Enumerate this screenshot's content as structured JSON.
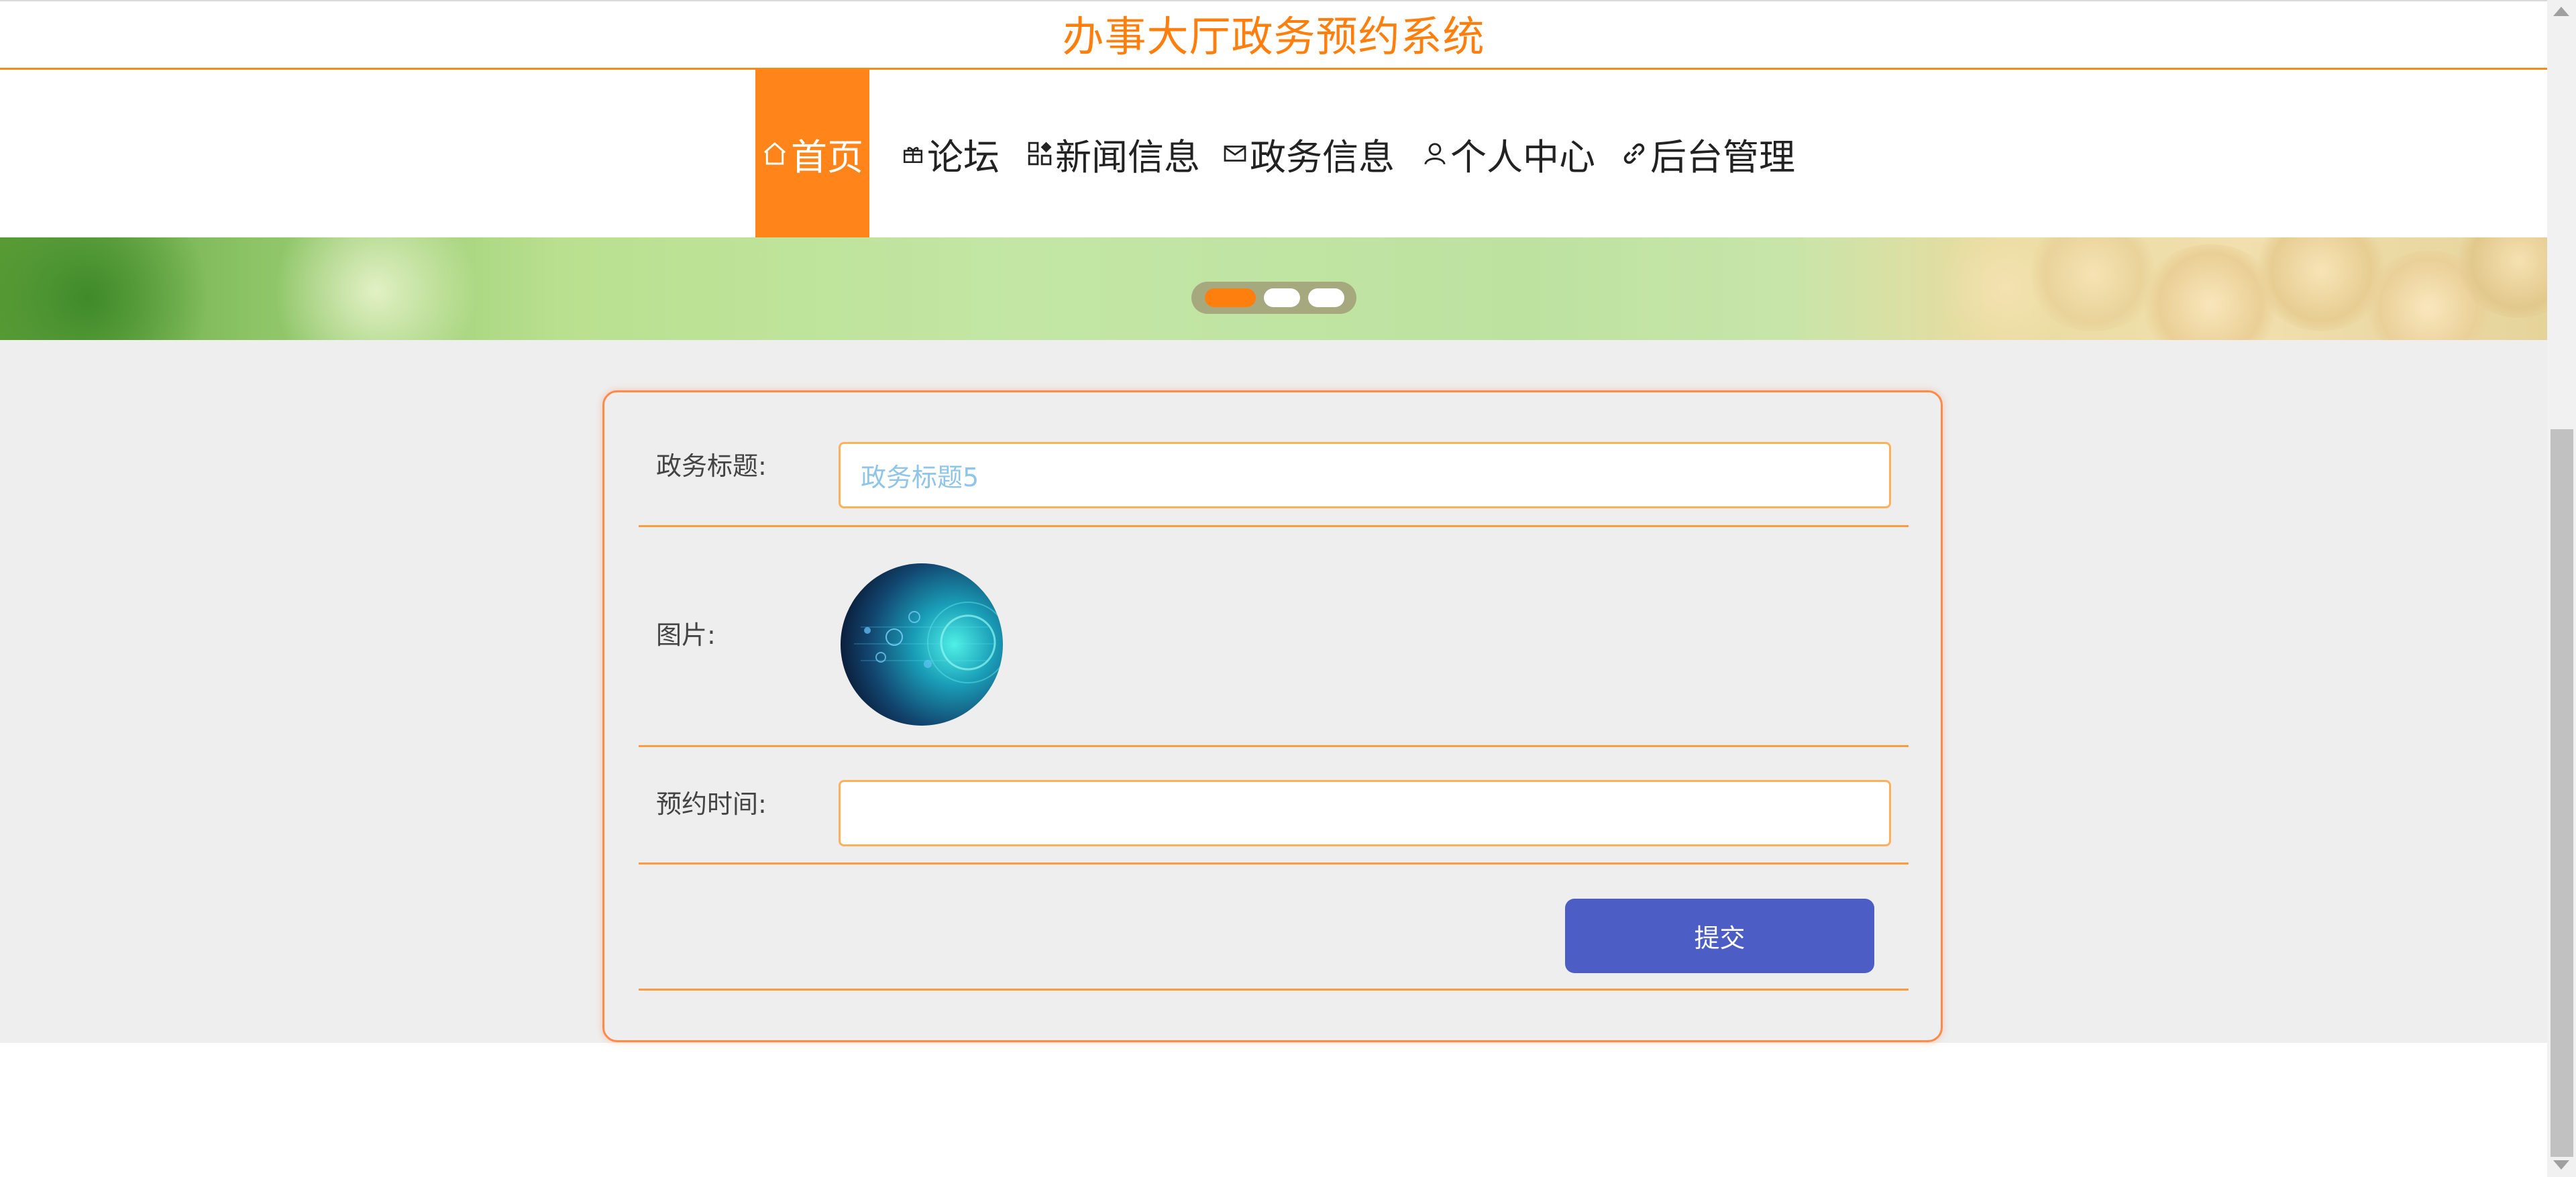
{
  "header": {
    "title": "办事大厅政务预约系统"
  },
  "nav": {
    "items": [
      {
        "label": "首页",
        "icon": "home-icon",
        "active": true
      },
      {
        "label": "论坛",
        "icon": "gift-icon",
        "active": false
      },
      {
        "label": "新闻信息",
        "icon": "grid-icon",
        "active": false
      },
      {
        "label": "政务信息",
        "icon": "mail-icon",
        "active": false
      },
      {
        "label": "个人中心",
        "icon": "user-icon",
        "active": false
      },
      {
        "label": "后台管理",
        "icon": "link-icon",
        "active": false
      }
    ]
  },
  "carousel": {
    "slides": 3,
    "active_index": 0
  },
  "form": {
    "title_label": "政务标题:",
    "title_value": "政务标题5",
    "image_label": "图片:",
    "time_label": "预约时间:",
    "time_value": "",
    "submit_label": "提交"
  },
  "colors": {
    "accent": "#ff7f0e",
    "nav_active_bg": "#ff8419",
    "submit_bg": "#4c5ec6",
    "input_text": "#8ec5e8"
  }
}
